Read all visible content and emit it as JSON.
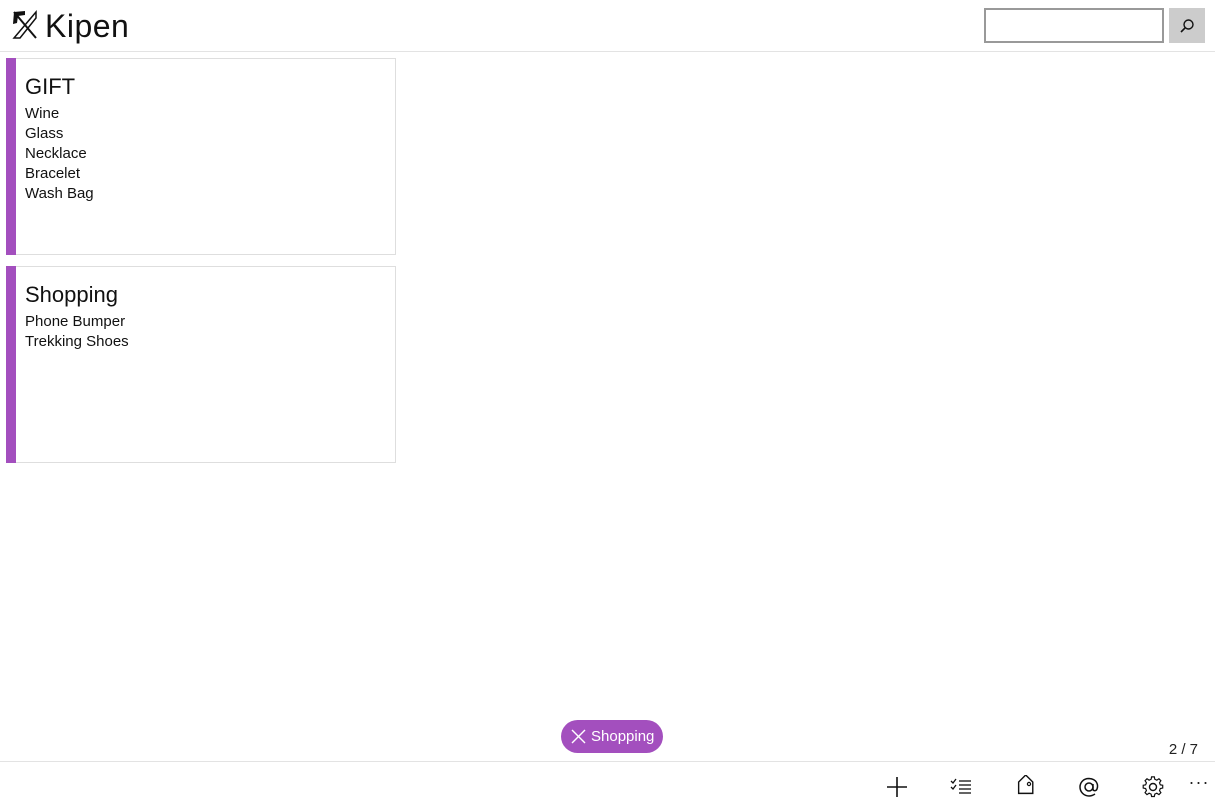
{
  "app": {
    "title": "Kipen"
  },
  "search": {
    "value": "",
    "placeholder": ""
  },
  "notes": [
    {
      "title": "GIFT",
      "color": "#a34fbe",
      "items": [
        "Wine",
        "Glass",
        "Necklace",
        "Bracelet",
        "Wash Bag"
      ]
    },
    {
      "title": "Shopping",
      "color": "#a34fbe",
      "items": [
        "Phone Bumper",
        "Trekking Shoes"
      ]
    }
  ],
  "filter": {
    "label": "Shopping",
    "color": "#a34fbe"
  },
  "pagination": {
    "text": "2 / 7"
  },
  "toolbar": {
    "icons": [
      "add-icon",
      "checklist-icon",
      "tag-icon",
      "mention-icon",
      "gear-icon",
      "more-icon"
    ],
    "more_label": "···"
  }
}
